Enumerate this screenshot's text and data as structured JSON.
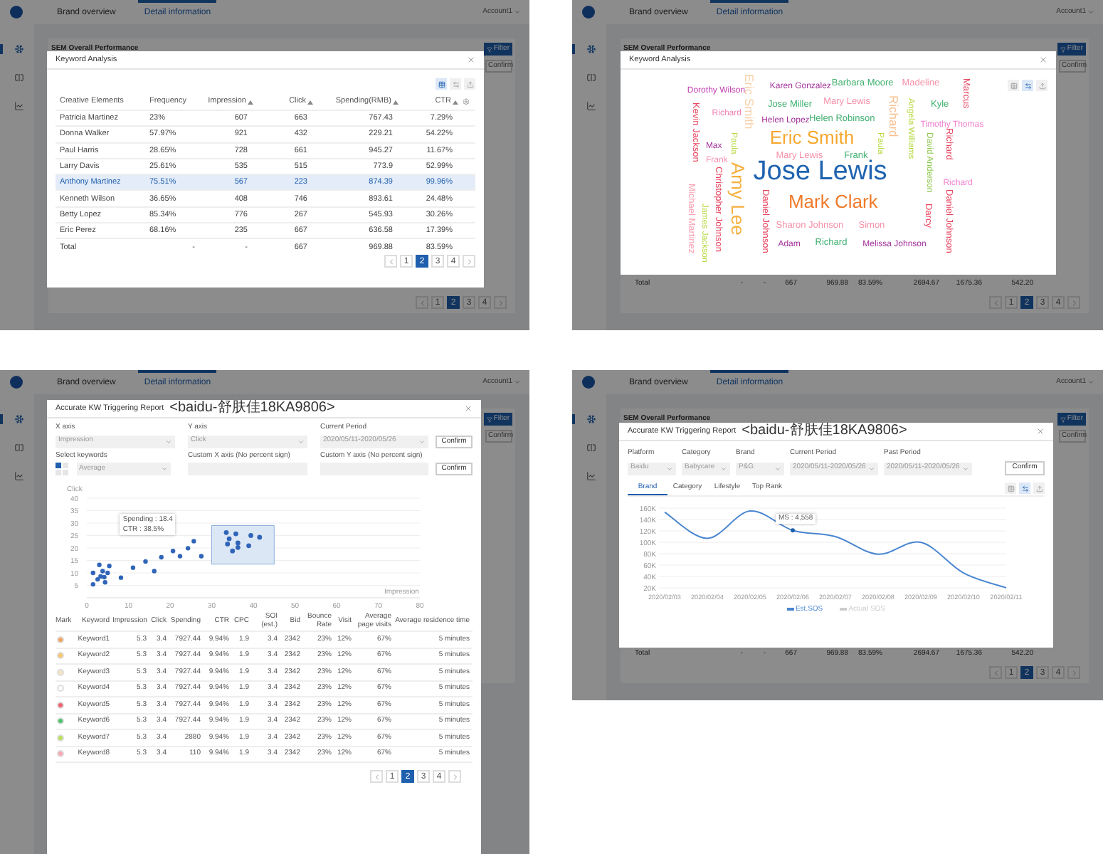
{
  "panels": [
    {
      "kind": "keyword_table",
      "app": {
        "tabs": [
          {
            "label": "Brand overview",
            "selected": false
          },
          {
            "label": "Detail information",
            "selected": true
          }
        ],
        "account": "Account1",
        "nav": [
          {
            "selected": true
          },
          {
            "selected": false
          },
          {
            "selected": false
          }
        ],
        "section_title": "SEM Overall Performance",
        "filter": "Filter",
        "confirm": "Confirm",
        "pages": [
          {
            "label": "1",
            "selected": false
          },
          {
            "label": "2",
            "selected": true
          },
          {
            "label": "3",
            "selected": false
          },
          {
            "label": "4",
            "selected": false
          }
        ]
      },
      "modal": {
        "title": "Keyword Analysis",
        "views": [
          {
            "selected": true
          },
          {
            "selected": false
          },
          {
            "selected": false
          }
        ],
        "columns": [
          {
            "label": "Creative Elements",
            "sortable": false
          },
          {
            "label": "Frequency",
            "sortable": false
          },
          {
            "label": "Impression",
            "sortable": true
          },
          {
            "label": "Click",
            "sortable": true
          },
          {
            "label": "Spending(RMB)",
            "sortable": true
          },
          {
            "label": "CTR",
            "sortable": true
          }
        ],
        "rows": [
          {
            "cells": [
              "Patricia Martinez",
              "23%",
              "607",
              "663",
              "767.43",
              "7.29%"
            ],
            "selected": false
          },
          {
            "cells": [
              "Donna Walker",
              "57.97%",
              "921",
              "432",
              "229.21",
              "54.22%"
            ],
            "selected": false
          },
          {
            "cells": [
              "Paul Harris",
              "28.65%",
              "728",
              "661",
              "945.27",
              "11.67%"
            ],
            "selected": false
          },
          {
            "cells": [
              "Larry Davis",
              "25.61%",
              "535",
              "515",
              "773.9",
              "52.99%"
            ],
            "selected": false
          },
          {
            "cells": [
              "Anthony Martinez",
              "75.51%",
              "567",
              "223",
              "874.39",
              "99.96%"
            ],
            "selected": true
          },
          {
            "cells": [
              "Kenneth Wilson",
              "36.65%",
              "408",
              "746",
              "893.61",
              "24.48%"
            ],
            "selected": false
          },
          {
            "cells": [
              "Betty Lopez",
              "85.34%",
              "776",
              "267",
              "545.93",
              "30.26%"
            ],
            "selected": false
          },
          {
            "cells": [
              "Eric Perez",
              "68.16%",
              "235",
              "667",
              "636.58",
              "17.39%"
            ],
            "selected": false
          }
        ],
        "total": [
          "Total",
          "-",
          "-",
          "667",
          "969.88",
          "83.59%"
        ],
        "pages": [
          {
            "label": "1",
            "selected": false
          },
          {
            "label": "2",
            "selected": true
          },
          {
            "label": "3",
            "selected": false
          },
          {
            "label": "4",
            "selected": false
          }
        ]
      }
    },
    {
      "kind": "word_cloud",
      "app": {
        "tabs": [
          {
            "label": "Brand overview",
            "selected": false
          },
          {
            "label": "Detail information",
            "selected": true
          }
        ],
        "account": "Account1",
        "nav": [
          {
            "selected": true
          },
          {
            "selected": false
          },
          {
            "selected": false
          }
        ],
        "section_title": "SEM Overall Performance",
        "filter": "Filter",
        "confirm": "Confirm",
        "total": [
          "Total",
          "-",
          "-",
          "667",
          "969.88",
          "83.59%",
          "2694.67",
          "1675.36",
          "542.20"
        ],
        "pages": [
          {
            "label": "1",
            "selected": false
          },
          {
            "label": "2",
            "selected": true
          },
          {
            "label": "3",
            "selected": false
          },
          {
            "label": "4",
            "selected": false
          }
        ]
      },
      "modal": {
        "title": "Keyword Analysis",
        "views": [
          {
            "selected": false
          },
          {
            "selected": true
          },
          {
            "selected": false
          }
        ],
        "words": [
          {
            "text": "Dorothy Wilson",
            "kind": "xs",
            "vertical": false,
            "color": "#c040b0"
          },
          {
            "text": "Eric Smith",
            "kind": "md",
            "vertical": true,
            "color": "#f8d0a8"
          },
          {
            "text": "Karen Gonzalez",
            "kind": "xs",
            "vertical": false,
            "color": "#a0309a"
          },
          {
            "text": "Barbara Moore",
            "kind": "sm",
            "vertical": false,
            "color": "#40b070"
          },
          {
            "text": "Madeline",
            "kind": "sm",
            "vertical": false,
            "color": "#f590a8"
          },
          {
            "text": "Marcus",
            "kind": "sm",
            "vertical": true,
            "color": "#e84560"
          },
          {
            "text": "Kevin Jackson",
            "kind": "sm",
            "vertical": true,
            "color": "#e84560"
          },
          {
            "text": "Richard",
            "kind": "xs",
            "vertical": false,
            "color": "#f080b0"
          },
          {
            "text": "Jose Miller",
            "kind": "sm",
            "vertical": false,
            "color": "#40b070"
          },
          {
            "text": "Mary Lewis",
            "kind": "sm",
            "vertical": false,
            "color": "#f590a8"
          },
          {
            "text": "Richard",
            "kind": "md",
            "vertical": true,
            "color": "#f8c090"
          },
          {
            "text": "Angela Williams",
            "kind": "xs",
            "vertical": true,
            "color": "#b8d840"
          },
          {
            "text": "Kyle",
            "kind": "sm",
            "vertical": false,
            "color": "#40b070"
          },
          {
            "text": "Helen Lopez",
            "kind": "xs",
            "vertical": false,
            "color": "#a0309a"
          },
          {
            "text": "Helen Robinson",
            "kind": "sm",
            "vertical": false,
            "color": "#40b070"
          },
          {
            "text": "Timothy Thomas",
            "kind": "xs",
            "vertical": false,
            "color": "#f080d0"
          },
          {
            "text": "Paula",
            "kind": "xs",
            "vertical": true,
            "color": "#b8d840"
          },
          {
            "text": "Eric Smith",
            "kind": "lg",
            "vertical": false,
            "color": "#f5a830"
          },
          {
            "text": "Paula",
            "kind": "xs",
            "vertical": true,
            "color": "#b8d840"
          },
          {
            "text": "David Anderson",
            "kind": "xs",
            "vertical": true,
            "color": "#90c850"
          },
          {
            "text": "Richard",
            "kind": "sm",
            "vertical": true,
            "color": "#e84560"
          },
          {
            "text": "Max",
            "kind": "xs",
            "vertical": false,
            "color": "#a0309a"
          },
          {
            "text": "Frank",
            "kind": "xs",
            "vertical": false,
            "color": "#f590b0"
          },
          {
            "text": "Mary Lewis",
            "kind": "sm",
            "vertical": false,
            "color": "#f590a8"
          },
          {
            "text": "Frank",
            "kind": "sm",
            "vertical": false,
            "color": "#40b070"
          },
          {
            "text": "Jose Lewis",
            "kind": "xl",
            "vertical": false,
            "color": "#1f63b0"
          },
          {
            "text": "Richard",
            "kind": "xs",
            "vertical": false,
            "color": "#f080d0"
          },
          {
            "text": "Michael Martinez",
            "kind": "sm",
            "vertical": true,
            "color": "#f8a0b0"
          },
          {
            "text": "Christopher Johnson",
            "kind": "sm",
            "vertical": true,
            "color": "#e84560"
          },
          {
            "text": "James Jackson",
            "kind": "xs",
            "vertical": true,
            "color": "#b8d840"
          },
          {
            "text": "Amy Lee",
            "kind": "lg",
            "vertical": true,
            "color": "#f5b040"
          },
          {
            "text": "Daniel Johnson",
            "kind": "sm",
            "vertical": true,
            "color": "#e84560"
          },
          {
            "text": "Mark Clark",
            "kind": "lg",
            "vertical": false,
            "color": "#f07a2a"
          },
          {
            "text": "Darcy",
            "kind": "sm",
            "vertical": true,
            "color": "#e84560"
          },
          {
            "text": "Daniel Johnson",
            "kind": "sm",
            "vertical": true,
            "color": "#e84560"
          },
          {
            "text": "Sharon Johnson",
            "kind": "sm",
            "vertical": false,
            "color": "#f590a8"
          },
          {
            "text": "Simon",
            "kind": "sm",
            "vertical": false,
            "color": "#f590a8"
          },
          {
            "text": "Adam",
            "kind": "xs",
            "vertical": false,
            "color": "#a0309a"
          },
          {
            "text": "Richard",
            "kind": "sm",
            "vertical": false,
            "color": "#40b070"
          },
          {
            "text": "Melissa Johnson",
            "kind": "xs",
            "vertical": false,
            "color": "#a0309a"
          }
        ]
      }
    },
    {
      "kind": "scatter_report",
      "app": {
        "tabs": [
          {
            "label": "Brand overview",
            "selected": false
          },
          {
            "label": "Detail information",
            "selected": true
          }
        ],
        "account": "Account1",
        "nav": [
          {
            "selected": true
          },
          {
            "selected": false
          },
          {
            "selected": false
          }
        ],
        "filter": "Filter",
        "confirm": "Confirm"
      },
      "modal": {
        "title": "Accurate KW Triggering Report",
        "subtitle": "<baidu-舒肤佳18KA9806>",
        "fields": [
          {
            "label": "X axis",
            "value": "Impression"
          },
          {
            "label": "Y axis",
            "value": "Click"
          },
          {
            "label": "Current Period",
            "value": "2020/05/11-2020/05/26"
          }
        ],
        "confirm": "Confirm",
        "keywords_label": "Select keywords",
        "keywords_value": "Average",
        "custom_fields": [
          {
            "label": "Custom X axis  (No percent sign)"
          },
          {
            "label": "Custom Y axis  (No percent sign)"
          }
        ],
        "confirm_2": "Confirm",
        "tooltip": [
          "Spending : 18.4",
          "CTR : 38.5%"
        ],
        "chart_data": {
          "type": "scatter",
          "xlabel": "Impression",
          "ylabel": "Click",
          "grid": true,
          "xlim": [
            0,
            80
          ],
          "ylim": [
            0,
            40
          ],
          "xticks": [
            0,
            10,
            20,
            30,
            40,
            50,
            60,
            70,
            80
          ],
          "yticks": [
            5,
            10,
            15,
            20,
            25,
            30,
            35,
            40
          ],
          "x": [
            1.5,
            1.5,
            2.6,
            3,
            3.3,
            3.8,
            4.2,
            4.4,
            5,
            5.4,
            8.2,
            11.1,
            14.1,
            16.2,
            17.9,
            20.7,
            22.4,
            24.3,
            25.7,
            27.5,
            33.5,
            35.8,
            34.2,
            33.8,
            36.3,
            36.3,
            35,
            39.4,
            41.5,
            38.9
          ],
          "series": [
            {
              "color": "#2f64b8",
              "values": [
                5.4,
                10,
                7.4,
                13.2,
                8.6,
                10.7,
                8.3,
                6.2,
                10,
                12.8,
                8.1,
                12.1,
                14.6,
                10.7,
                16.3,
                18.8,
                16.7,
                19.9,
                22.7,
                16.7,
                26.2,
                25.7,
                23.7,
                21.6,
                22,
                20.2,
                18.8,
                25,
                24.3,
                20.9
              ]
            }
          ]
        },
        "mark_header": "Mark",
        "columns": [
          "Keyword",
          "Impression",
          "Click",
          "Spending",
          "CTR",
          "CPC",
          "SOI  (est.)",
          "Bid",
          "Bounce Rate",
          "Visit",
          "Average page visits",
          "Average residence time"
        ],
        "rows": [
          {
            "color": "#f5a35c",
            "cells": [
              "Keyword1",
              "5.3",
              "3.4",
              "7927.44",
              "9.94%",
              "1.9",
              "3.4",
              "2342",
              "23%",
              "12%",
              "67%",
              "5 minutes"
            ]
          },
          {
            "color": "#f7c56a",
            "cells": [
              "Keyword2",
              "5.3",
              "3.4",
              "7927.44",
              "9.94%",
              "1.9",
              "3.4",
              "2342",
              "23%",
              "12%",
              "67%",
              "5 minutes"
            ]
          },
          {
            "color": "#f8e3c4",
            "cells": [
              "Keyword3",
              "5.3",
              "3.4",
              "7927.44",
              "9.94%",
              "1.9",
              "3.4",
              "2342",
              "23%",
              "12%",
              "67%",
              "5 minutes"
            ]
          },
          {
            "color": "#ffffff",
            "cells": [
              "Keyword4",
              "5.3",
              "3.4",
              "7927.44",
              "9.94%",
              "1.9",
              "3.4",
              "2342",
              "23%",
              "12%",
              "67%",
              "5 minutes"
            ]
          },
          {
            "color": "#f06070",
            "cells": [
              "Keyword5",
              "5.3",
              "3.4",
              "7927.44",
              "9.94%",
              "1.9",
              "3.4",
              "2342",
              "23%",
              "12%",
              "67%",
              "5 minutes"
            ]
          },
          {
            "color": "#4cc46c",
            "cells": [
              "Keyword6",
              "5.3",
              "3.4",
              "7927.44",
              "9.94%",
              "1.9",
              "3.4",
              "2342",
              "23%",
              "12%",
              "67%",
              "5 minutes"
            ]
          },
          {
            "color": "#b8e05a",
            "cells": [
              "Keyword7",
              "5.3",
              "3.4",
              "2880",
              "9.94%",
              "1.9",
              "3.4",
              "2342",
              "23%",
              "12%",
              "67%",
              "5 minutes"
            ]
          },
          {
            "color": "#f8a8b0",
            "cells": [
              "Keyword8",
              "5.3",
              "3.4",
              "110",
              "9.94%",
              "1.9",
              "3.4",
              "2342",
              "23%",
              "12%",
              "67%",
              "5 minutes"
            ]
          }
        ],
        "pages": [
          {
            "label": "1",
            "selected": false
          },
          {
            "label": "2",
            "selected": true
          },
          {
            "label": "3",
            "selected": false
          },
          {
            "label": "4",
            "selected": false
          }
        ]
      }
    },
    {
      "kind": "trend_report",
      "app": {
        "tabs": [
          {
            "label": "Brand overview",
            "selected": false
          },
          {
            "label": "Detail information",
            "selected": true
          }
        ],
        "account": "Account1",
        "nav": [
          {
            "selected": true
          },
          {
            "selected": false
          },
          {
            "selected": false
          }
        ],
        "section_title": "SEM Overall Performance",
        "filter": "Filter",
        "confirm": "Confirm",
        "total": [
          "Total",
          "-",
          "-",
          "667",
          "969.88",
          "83.59%",
          "2694.67",
          "1675.36",
          "542.20"
        ],
        "pages": [
          {
            "label": "1",
            "selected": false
          },
          {
            "label": "2",
            "selected": true
          },
          {
            "label": "3",
            "selected": false
          },
          {
            "label": "4",
            "selected": false
          }
        ]
      },
      "modal": {
        "title": "Accurate KW Triggering Report",
        "subtitle": "<baidu-舒肤佳18KA9806>",
        "fields": [
          {
            "label": "Platform",
            "value": "Baidu"
          },
          {
            "label": "Category",
            "value": "Babycare"
          },
          {
            "label": "Brand",
            "value": "P&G"
          },
          {
            "label": "Current Period",
            "value": "2020/05/11-2020/05/26"
          },
          {
            "label": "Past Period",
            "value": "2020/05/11-2020/05/26"
          }
        ],
        "confirm": "Confirm",
        "tabs": [
          {
            "label": "Brand",
            "selected": true
          },
          {
            "label": "Category",
            "selected": false
          },
          {
            "label": "Lifestyle",
            "selected": false
          },
          {
            "label": "Top Rank",
            "selected": false
          }
        ],
        "views": [
          {
            "selected": false
          },
          {
            "selected": true
          },
          {
            "selected": false
          }
        ],
        "tooltip": "MS : 4,558",
        "chart_data": {
          "type": "line",
          "grid": true,
          "categories": [
            "2020/02/03",
            "2020/02/04",
            "2020/02/05",
            "2020/02/06",
            "2020/02/07",
            "2020/02/08",
            "2020/02/09",
            "2020/02/10",
            "2020/02/11"
          ],
          "ylim": [
            20000,
            160000
          ],
          "yticks": [
            {
              "value": 20000,
              "label": "20K"
            },
            {
              "value": 40000,
              "label": "40K"
            },
            {
              "value": 60000,
              "label": "60K"
            },
            {
              "value": 80000,
              "label": "80K"
            },
            {
              "value": 100000,
              "label": "100K"
            },
            {
              "value": 120000,
              "label": "120K"
            },
            {
              "value": 140000,
              "label": "140K"
            },
            {
              "value": 160000,
              "label": "160K"
            }
          ],
          "series": [
            {
              "name": "Est.SOS",
              "color": "#4a86d0",
              "values": [
                153000,
                107000,
                155000,
                121000,
                110000,
                79000,
                100000,
                46000,
                20000
              ]
            },
            {
              "name": "Actual SOS",
              "color": "#cccccc",
              "values": [
                null,
                null,
                null,
                null,
                null,
                null,
                null,
                null,
                null
              ]
            }
          ]
        }
      }
    }
  ]
}
